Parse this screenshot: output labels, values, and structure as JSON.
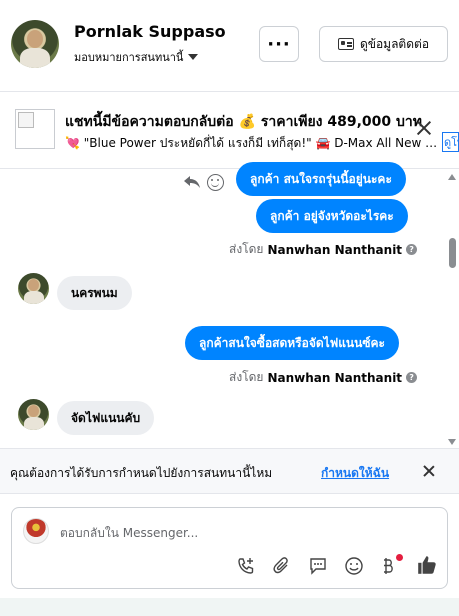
{
  "header": {
    "name": "Pornlak Suppaso",
    "assign_label": "มอบหมายการสนทนานี้",
    "more_label": "···",
    "contact_label": "ดูข้อมูลติดต่อ"
  },
  "ad": {
    "title": "แชทนี้มีข้อความตอบกลับต่อ 💰 ราคาเพียง 489,000 บาท",
    "subtitle": "💘 \"Blue Power ประหยัดกี่ได้ แรงก็มี เท่ก็สุด!\" 🚘 D-Max All New Blue...",
    "link_label": "ดูโพสต์"
  },
  "messages": [
    {
      "direction": "out",
      "text": "ลูกค้า  สนใจรถรุ่นนี้อยู่นะคะ"
    },
    {
      "direction": "out",
      "text": "ลูกค้า อยู่จังหวัดอะไรคะ"
    },
    {
      "type": "sentby",
      "prefix": "ส่งโดย",
      "agent": "Nanwhan Nanthanit"
    },
    {
      "direction": "in",
      "text": "นครพนม"
    },
    {
      "direction": "out",
      "text": "ลูกค้าสนใจซื้อสดหรือจัดไฟแนนซ์คะ"
    },
    {
      "type": "sentby",
      "prefix": "ส่งโดย",
      "agent": "Nanwhan Nanthanit"
    },
    {
      "direction": "in",
      "text": "จัดไฟแนนคับ"
    }
  ],
  "assign_bar": {
    "text": "คุณต้องการได้รับการกำหนดไปยังการสนทนานี้ไหม",
    "link": "กำหนดให้ฉัน"
  },
  "composer": {
    "placeholder": "ตอบกลับใน Messenger...",
    "tools": [
      "phone-plus-icon",
      "paperclip-icon",
      "saved-reply-icon",
      "emoji-icon",
      "baht-icon",
      "thumbs-up-icon"
    ]
  },
  "colors": {
    "accent": "#0084ff",
    "link": "#1877f2",
    "incoming_bubble": "#eceef1"
  }
}
